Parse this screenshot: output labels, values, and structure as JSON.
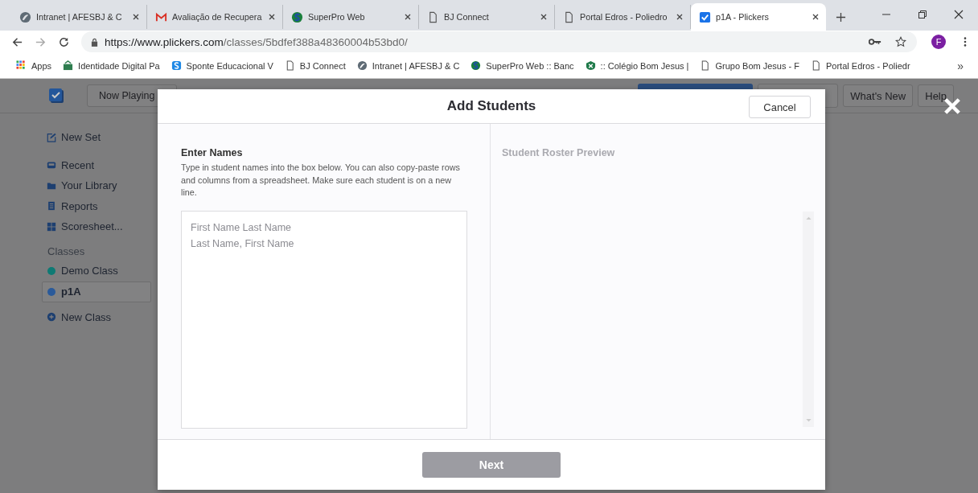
{
  "browser": {
    "tabs": [
      {
        "title": "Intranet | AFESBJ & C",
        "kind": "plume",
        "selected": false
      },
      {
        "title": "Avaliação de Recupera",
        "kind": "gmail",
        "selected": false
      },
      {
        "title": "SuperPro Web",
        "kind": "superpro",
        "selected": false
      },
      {
        "title": "BJ Connect",
        "kind": "page",
        "selected": false
      },
      {
        "title": "Portal Edros - Poliedro",
        "kind": "page",
        "selected": false
      },
      {
        "title": "p1A - Plickers",
        "kind": "check",
        "selected": true
      }
    ],
    "url": {
      "host": "https://www.plickers.com",
      "path": "/classes/5bdfef388a48360004b53bd0/"
    },
    "profile": "F",
    "bookmarks": [
      {
        "label": "Apps",
        "kind": "apps"
      },
      {
        "label": "Identidade Digital Pa",
        "kind": "identidade"
      },
      {
        "label": "Sponte Educacional V",
        "kind": "sponte"
      },
      {
        "label": "BJ Connect",
        "kind": "page"
      },
      {
        "label": "Intranet | AFESBJ & C",
        "kind": "plume"
      },
      {
        "label": "SuperPro Web :: Banc",
        "kind": "superpro"
      },
      {
        "label": ":: Colégio Bom Jesus |",
        "kind": "colegio"
      },
      {
        "label": "Grupo Bom Jesus - F",
        "kind": "page"
      },
      {
        "label": "Portal Edros - Poliedr",
        "kind": "page"
      }
    ],
    "more": "»"
  },
  "app": {
    "now_playing": "Now Playing",
    "nav_buttons": [
      "What's New",
      "Help"
    ],
    "sidebar": [
      {
        "label": "New Set",
        "kind": "edit"
      },
      {
        "label": "Recent",
        "kind": "recent"
      },
      {
        "label": "Your Library",
        "kind": "folder"
      },
      {
        "label": "Reports",
        "kind": "report"
      },
      {
        "label": "Scoresheet...",
        "kind": "grid"
      }
    ],
    "classes_heading": "Classes",
    "classes": [
      {
        "label": "Demo Class",
        "color": "#0e7a74",
        "selected": false
      },
      {
        "label": "p1A",
        "color": "#2a5a9a",
        "selected": true
      }
    ],
    "new_class": "New Class"
  },
  "modal": {
    "title": "Add Students",
    "cancel": "Cancel",
    "enter_names": "Enter Names",
    "description": "Type in student names into the box below. You can also copy-paste rows and columns from a spreadsheet. Make sure each student is on a new line.",
    "placeholder": "First Name Last Name\nLast Name, First Name",
    "preview_heading": "Student Roster Preview",
    "next": {
      "label": "Next",
      "disabled": true
    }
  }
}
